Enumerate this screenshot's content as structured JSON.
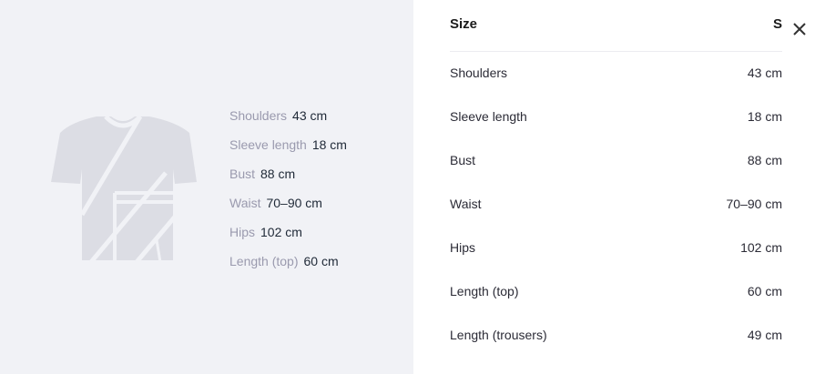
{
  "colors": {
    "left_background": "#f1f2f6",
    "silhouette": "#dcdde4",
    "label_muted": "#9a9aae"
  },
  "illustration": {
    "icon": "tshirt-silhouette-icon"
  },
  "measurements": [
    {
      "label": "Shoulders",
      "value": "43 cm"
    },
    {
      "label": "Sleeve length",
      "value": "18 cm"
    },
    {
      "label": "Bust",
      "value": "88 cm"
    },
    {
      "label": "Waist",
      "value": "70–90 cm"
    },
    {
      "label": "Hips",
      "value": "102 cm"
    },
    {
      "label": "Length (top)",
      "value": "60 cm"
    }
  ],
  "size_panel": {
    "title": "Size",
    "selected_size": "S",
    "close_icon": "close-icon",
    "rows": [
      {
        "label": "Shoulders",
        "value": "43 cm"
      },
      {
        "label": "Sleeve length",
        "value": "18 cm"
      },
      {
        "label": "Bust",
        "value": "88 cm"
      },
      {
        "label": "Waist",
        "value": "70–90 cm"
      },
      {
        "label": "Hips",
        "value": "102 cm"
      },
      {
        "label": "Length (top)",
        "value": "60 cm"
      },
      {
        "label": "Length (trousers)",
        "value": "49 cm"
      }
    ]
  }
}
